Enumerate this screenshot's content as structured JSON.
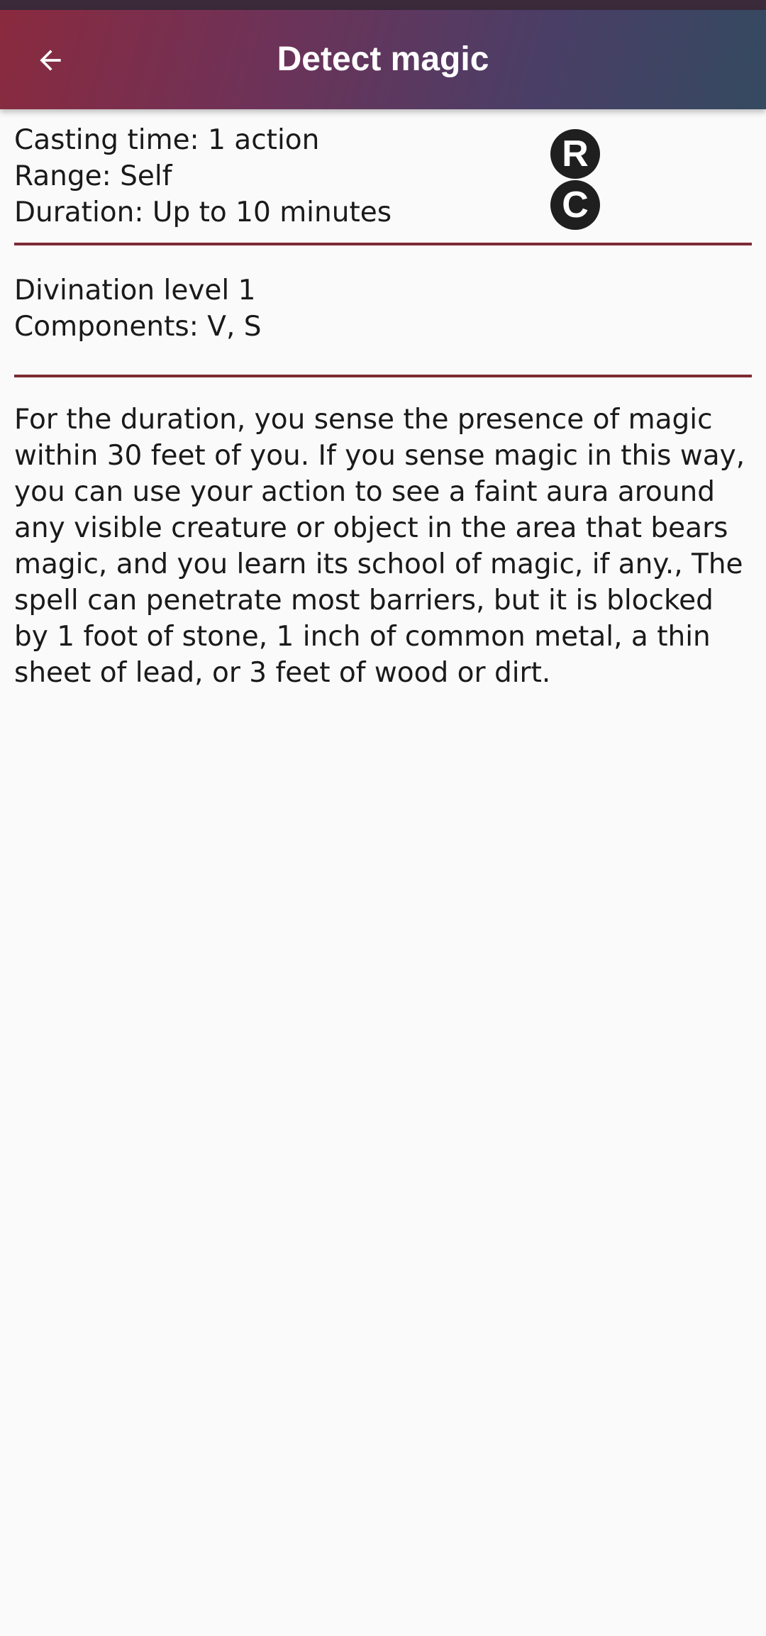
{
  "app_bar": {
    "title": "Detect magic",
    "back_icon": "arrow-left-icon"
  },
  "spell": {
    "casting_time": "Casting time: 1 action",
    "range": "Range: Self",
    "duration": "Duration: Up to 10 minutes",
    "badges": {
      "ritual": "R",
      "concentration": "C"
    },
    "school_level": "Divination level 1",
    "components": "Components: V, S",
    "description": "For the duration, you sense the presence of magic within 30 feet of you. If you sense magic in this way, you can use your action to see a faint aura around any visible creature or object in the area that bears magic, and you learn its school of magic, if any., The spell can penetrate most barriers, but it is blocked by 1 foot of stone, 1 inch of common metal, a thin sheet of lead, or 3 feet of wood or dirt."
  },
  "colors": {
    "divider": "#7e2a36",
    "app_bar_start": "#8a2a3e",
    "app_bar_end": "#344a60",
    "badge_bg": "#1f1f1f"
  }
}
